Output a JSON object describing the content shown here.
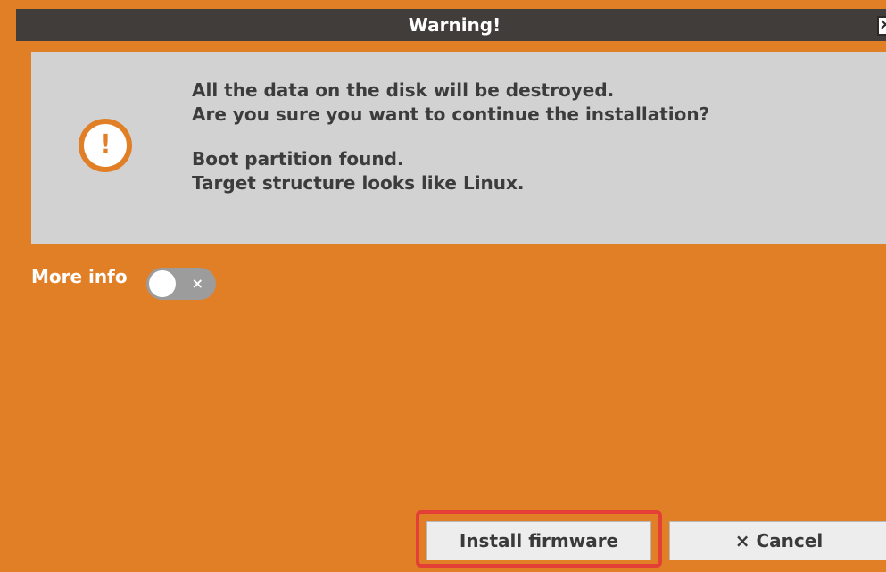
{
  "window": {
    "title": "Warning!",
    "close_glyph": "×"
  },
  "icon": {
    "name": "exclamation-icon",
    "glyph": "!"
  },
  "message": {
    "lines": [
      "All the data on the disk will be destroyed.",
      "Are you sure you want to continue the installation?",
      "Boot partition found.",
      "Target structure looks like Linux."
    ]
  },
  "more_info": {
    "label": "More info",
    "toggle_state": "off",
    "toggle_glyph": "×"
  },
  "buttons": {
    "install_label": "Install firmware",
    "cancel_label": "× Cancel"
  },
  "colors": {
    "accent": "#e17f27",
    "titlebar": "#413d3a",
    "panel": "#d2d2d2",
    "highlight": "#e33f36"
  }
}
